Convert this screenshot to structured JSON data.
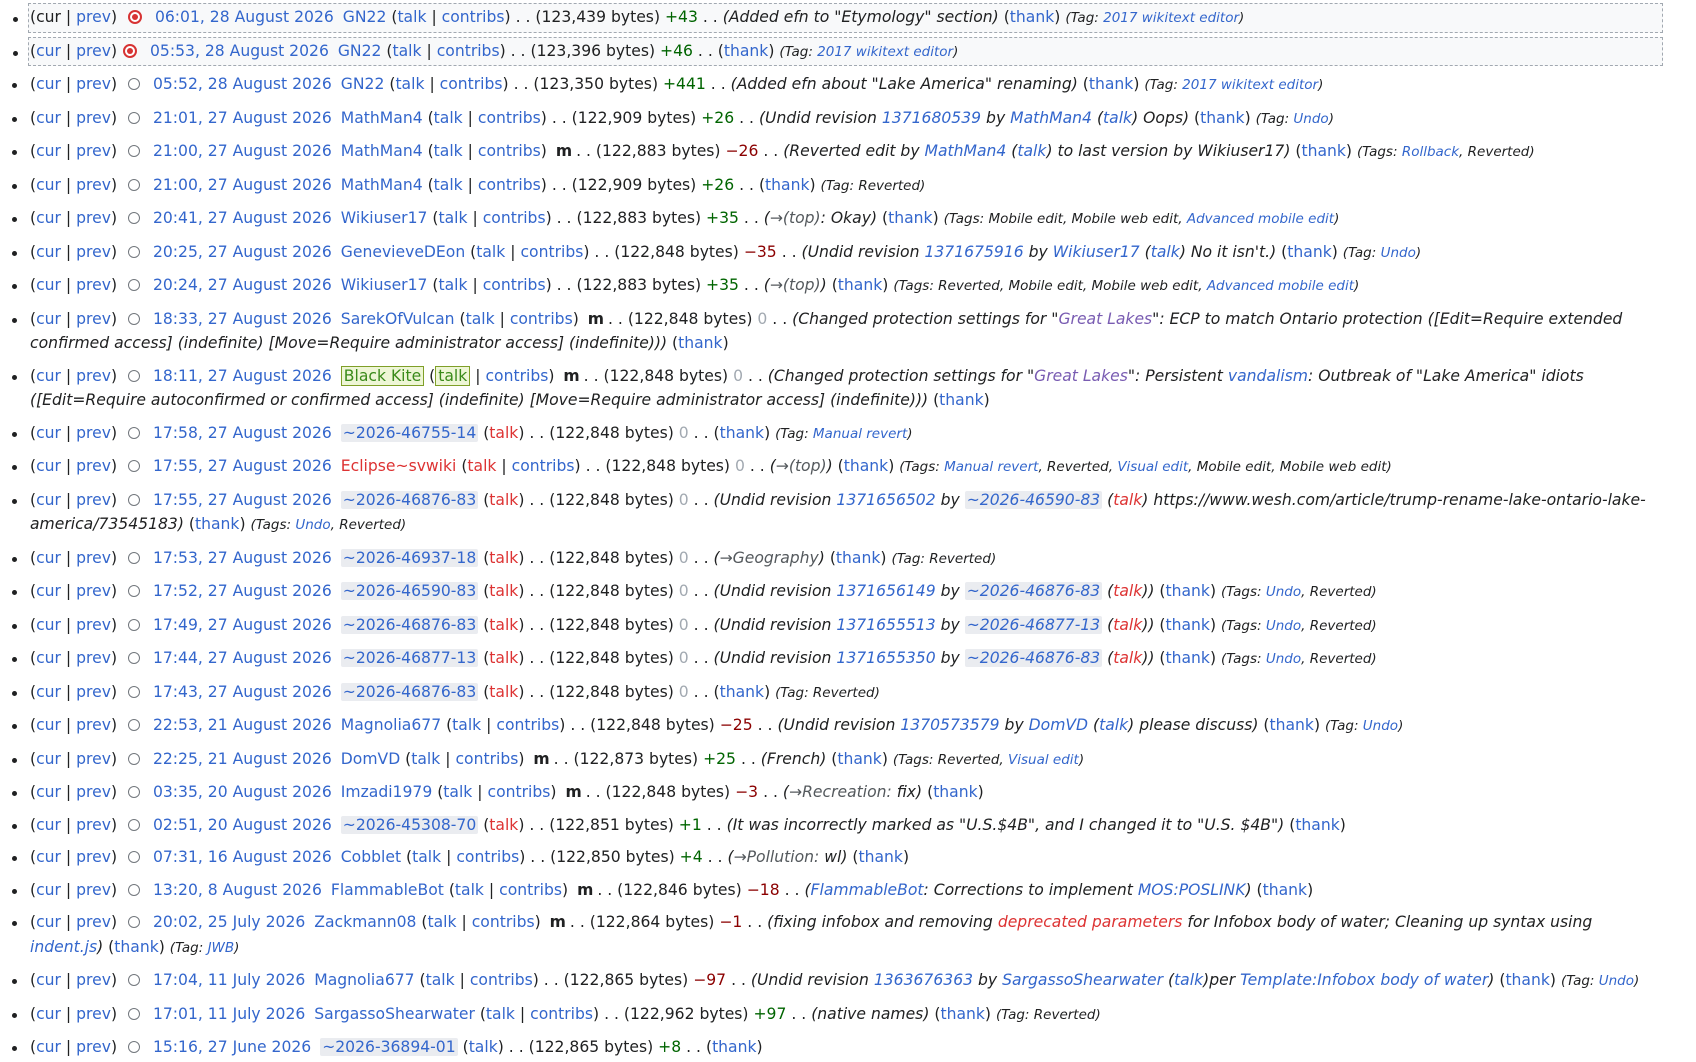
{
  "labels": {
    "cur": "cur",
    "prev": "prev",
    "talk": "talk",
    "contribs": "contribs",
    "thank": "thank",
    "minor": "m",
    "tag": "Tag",
    "tags": "Tags",
    "by": "by",
    "bytes_suffix": "bytes",
    "sep": ". .",
    "pipe": "|"
  },
  "rows": [
    {
      "date": "06:01, 28 August 2026",
      "user": "GN22",
      "bytes": "123,439",
      "diff": "+43",
      "comment": "Added efn to \"Etymology\" section",
      "tags": "2017 wikitext editor",
      "tag_label": "Tag"
    },
    {
      "date": "05:53, 28 August 2026",
      "user": "GN22",
      "bytes": "123,396",
      "diff": "+46",
      "tags": "2017 wikitext editor",
      "tag_label": "Tag"
    },
    {
      "date": "05:52, 28 August 2026",
      "user": "GN22",
      "bytes": "123,350",
      "diff": "+441",
      "comment": "Added efn about \"Lake America\" renaming",
      "tags": "2017 wikitext editor",
      "tag_label": "Tag"
    },
    {
      "date": "21:01, 27 August 2026",
      "user": "MathMan4",
      "bytes": "122,909",
      "diff": "+26",
      "c_pre": "Undid revision",
      "c_rev": "1371680539",
      "c_by_user": "MathMan4",
      "c_post": "Oops",
      "tag_label": "Tag",
      "tags": "Undo"
    },
    {
      "date": "21:00, 27 August 2026",
      "user": "MathMan4",
      "bytes": "122,883",
      "diff": "−26",
      "c_pre": "Reverted edit by",
      "c_user": "MathMan4",
      "c_post": "to last version by Wikiuser17",
      "tag_label": "Tags",
      "tags": "Rollback",
      "tags2": "Reverted"
    },
    {
      "date": "21:00, 27 August 2026",
      "user": "MathMan4",
      "bytes": "122,909",
      "diff": "+26",
      "tag_label": "Tag",
      "tags2": "Reverted"
    },
    {
      "date": "20:41, 27 August 2026",
      "user": "Wikiuser17",
      "bytes": "122,883",
      "diff": "+35",
      "section": "→(top)",
      "comment": "Okay",
      "tag_label": "Tags",
      "tags2": "Mobile edit, Mobile web edit,",
      "tags": "Advanced mobile edit"
    },
    {
      "date": "20:25, 27 August 2026",
      "user": "GenevieveDEon",
      "bytes": "122,848",
      "diff": "−35",
      "c_pre": "Undid revision",
      "c_rev": "1371675916",
      "c_by_user": "Wikiuser17",
      "c_post": "No it isn't.",
      "tag_label": "Tag",
      "tags": "Undo"
    },
    {
      "date": "20:24, 27 August 2026",
      "user": "Wikiuser17",
      "bytes": "122,883",
      "diff": "+35",
      "section": "→(top)",
      "tag_label": "Tags",
      "tags2": "Reverted, Mobile edit, Mobile web edit,",
      "tags": "Advanced mobile edit"
    },
    {
      "date": "18:33, 27 August 2026",
      "user": "SarekOfVulcan",
      "bytes": "122,848",
      "diff": "0",
      "c_pre": "Changed protection settings for \"",
      "c_page": "Great Lakes",
      "c_post": "\": ECP to match Ontario protection ([Edit=Require extended confirmed access] (indefinite) [Move=Require administrator access] (indefinite))"
    },
    {
      "date": "18:11, 27 August 2026",
      "user": "Black Kite",
      "bytes": "122,848",
      "diff": "0",
      "c_pre": "Changed protection settings for \"",
      "c_page": "Great Lakes",
      "c_mid": "\": Persistent",
      "c_link": "vandalism",
      "c_post": ": Outbreak of \"Lake America\" idiots ([Edit=Require autoconfirmed or confirmed access] (indefinite) [Move=Require administrator access] (indefinite))"
    },
    {
      "date": "17:58, 27 August 2026",
      "user": "~2026-46755-14",
      "bytes": "122,848",
      "diff": "0",
      "tag_label": "Tag",
      "tags": "Manual revert"
    },
    {
      "date": "17:55, 27 August 2026",
      "user": "Eclipse~svwiki",
      "bytes": "122,848",
      "diff": "0",
      "section": "→(top)",
      "tag_label": "Tags",
      "tags": "Manual revert",
      "tags2": ", Reverted,",
      "tags3": "Visual edit",
      "tags4": ", Mobile edit, Mobile web edit"
    },
    {
      "date": "17:55, 27 August 2026",
      "user": "~2026-46876-83",
      "bytes": "122,848",
      "diff": "0",
      "c_pre": "Undid revision",
      "c_rev": "1371656502",
      "c_by_ip": "~2026-46590-83",
      "c_post": "https://www.wesh.com/article/trump-rename-lake-ontario-lake-america/73545183",
      "tag_label": "Tags",
      "tags": "Undo",
      "tags2": ", Reverted"
    },
    {
      "date": "17:53, 27 August 2026",
      "user": "~2026-46937-18",
      "bytes": "122,848",
      "diff": "0",
      "section": "→Geography",
      "tag_label": "Tag",
      "tags2": "Reverted"
    },
    {
      "date": "17:52, 27 August 2026",
      "user": "~2026-46590-83",
      "bytes": "122,848",
      "diff": "0",
      "c_pre": "Undid revision",
      "c_rev": "1371656149",
      "c_by_ip": "~2026-46876-83",
      "tag_label": "Tags",
      "tags": "Undo",
      "tags2": ", Reverted"
    },
    {
      "date": "17:49, 27 August 2026",
      "user": "~2026-46876-83",
      "bytes": "122,848",
      "diff": "0",
      "c_pre": "Undid revision",
      "c_rev": "1371655513",
      "c_by_ip": "~2026-46877-13",
      "tag_label": "Tags",
      "tags": "Undo",
      "tags2": ", Reverted"
    },
    {
      "date": "17:44, 27 August 2026",
      "user": "~2026-46877-13",
      "bytes": "122,848",
      "diff": "0",
      "c_pre": "Undid revision",
      "c_rev": "1371655350",
      "c_by_ip": "~2026-46876-83",
      "tag_label": "Tags",
      "tags": "Undo",
      "tags2": ", Reverted"
    },
    {
      "date": "17:43, 27 August 2026",
      "user": "~2026-46876-83",
      "bytes": "122,848",
      "diff": "0",
      "tag_label": "Tag",
      "tags2": "Reverted"
    },
    {
      "date": "22:53, 21 August 2026",
      "user": "Magnolia677",
      "bytes": "122,848",
      "diff": "−25",
      "c_pre": "Undid revision",
      "c_rev": "1370573579",
      "c_by_user": "DomVD",
      "c_post": "please discuss",
      "tag_label": "Tag",
      "tags": "Undo"
    },
    {
      "date": "22:25, 21 August 2026",
      "user": "DomVD",
      "bytes": "122,873",
      "diff": "+25",
      "comment": "French",
      "tag_label": "Tags",
      "tags2": "Reverted,",
      "tags": "Visual edit"
    },
    {
      "date": "03:35, 20 August 2026",
      "user": "Imzadi1979",
      "bytes": "122,848",
      "diff": "−3",
      "section": "→Recreation:",
      "comment": "fix"
    },
    {
      "date": "02:51, 20 August 2026",
      "user": "~2026-45308-70",
      "bytes": "122,851",
      "diff": "+1",
      "comment": "It was incorrectly marked as \"U.S.$4B\", and I changed it to \"U.S. $4B\""
    },
    {
      "date": "07:31, 16 August 2026",
      "user": "Cobblet",
      "bytes": "122,850",
      "diff": "+4",
      "section": "→Pollution:",
      "comment": "wl"
    },
    {
      "date": "13:20, 8 August 2026",
      "user": "FlammableBot",
      "bytes": "122,846",
      "diff": "−18",
      "c_user_first": "FlammableBot",
      "c_mid": ": Corrections to implement",
      "c_link": "MOS:POSLINK"
    },
    {
      "date": "20:02, 25 July 2026",
      "user": "Zackmann08",
      "bytes": "122,864",
      "diff": "−1",
      "c_pre": "fixing infobox and removing",
      "c_redlink": "deprecated parameters",
      "c_mid": "for Infobox body of water; Cleaning up syntax using",
      "c_link": "indent.js",
      "tag_label": "Tag",
      "tags": "JWB"
    },
    {
      "date": "17:04, 11 July 2026",
      "user": "Magnolia677",
      "bytes": "122,865",
      "diff": "−97",
      "c_pre": "Undid revision",
      "c_rev": "1363676363",
      "c_by_user": "SargassoShearwater",
      "c_talk_mid": "per",
      "c_link": "Template:Infobox body of water",
      "tag_label": "Tag",
      "tags": "Undo"
    },
    {
      "date": "17:01, 11 July 2026",
      "user": "SargassoShearwater",
      "bytes": "122,962",
      "diff": "+97",
      "comment": "native names",
      "tag_label": "Tag",
      "tags2": "Reverted"
    },
    {
      "date": "15:16, 27 June 2026",
      "user": "~2026-36894-01",
      "bytes": "122,865",
      "diff": "+8"
    }
  ]
}
